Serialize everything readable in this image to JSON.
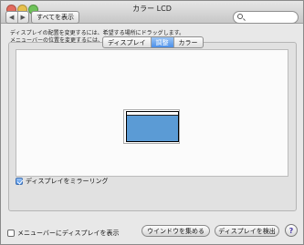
{
  "window": {
    "title": "カラー LCD"
  },
  "toolbar": {
    "back": "◀",
    "forward": "▶",
    "show_all": "すべてを表示",
    "search_placeholder": ""
  },
  "tabs": [
    {
      "label": "ディスプレイ",
      "selected": false
    },
    {
      "label": "調整",
      "selected": true
    },
    {
      "label": "カラー",
      "selected": false
    }
  ],
  "description": {
    "line1": "ディスプレイの配置を変更するには、希望する場所にドラッグします。",
    "line2": "メニューバーの位置を変更するには、別のディスプレイにドラッグします。"
  },
  "mirror": {
    "label": "ディスプレイをミラーリング",
    "checked": true
  },
  "menu_show": {
    "label": "メニューバーにディスプレイを表示",
    "checked": false
  },
  "buttons": {
    "gather": "ウインドウを集める",
    "detect": "ディスプレイを検出",
    "help": "?"
  },
  "colors": {
    "display_fill": "#5b9bd5",
    "accent": "#4a8fe8"
  }
}
